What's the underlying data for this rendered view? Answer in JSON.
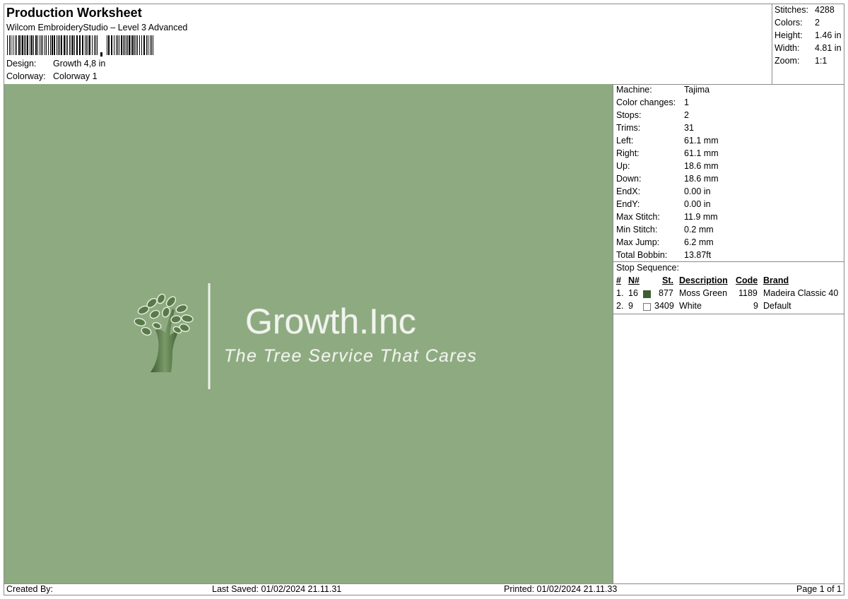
{
  "header": {
    "title": "Production Worksheet",
    "subtitle": "Wilcom EmbroideryStudio – Level 3 Advanced",
    "design_label": "Design:",
    "design_value": "Growth 4,8 in",
    "colorway_label": "Colorway:",
    "colorway_value": "Colorway 1"
  },
  "summary": [
    {
      "label": "Stitches:",
      "value": "4288"
    },
    {
      "label": "Colors:",
      "value": "2"
    },
    {
      "label": "Height:",
      "value": "1.46 in"
    },
    {
      "label": "Width:",
      "value": "4.81 in"
    },
    {
      "label": "Zoom:",
      "value": "1:1"
    }
  ],
  "design": {
    "background_color": "#8eaa80",
    "brand_name": "Growth.Inc",
    "tagline": "The Tree Service That Cares",
    "tree_color": "#4a6b3c"
  },
  "machine_info": [
    {
      "label": "Machine:",
      "value": "Tajima"
    },
    {
      "label": "Color changes:",
      "value": "1"
    },
    {
      "label": "Stops:",
      "value": "2"
    },
    {
      "label": "Trims:",
      "value": "31"
    },
    {
      "label": "Left:",
      "value": "61.1 mm"
    },
    {
      "label": "Right:",
      "value": "61.1 mm"
    },
    {
      "label": "Up:",
      "value": "18.6 mm"
    },
    {
      "label": "Down:",
      "value": "18.6 mm"
    },
    {
      "label": "EndX:",
      "value": "0.00 in"
    },
    {
      "label": "EndY:",
      "value": "0.00 in"
    },
    {
      "label": "Max Stitch:",
      "value": "11.9 mm"
    },
    {
      "label": "Min Stitch:",
      "value": "0.2 mm"
    },
    {
      "label": "Max Jump:",
      "value": "6.2 mm"
    },
    {
      "label": "Total Bobbin:",
      "value": "13.87ft"
    }
  ],
  "stop_sequence": {
    "title": "Stop Sequence:",
    "headers": {
      "num": "#",
      "n": "N#",
      "st": "St.",
      "description": "Description",
      "code": "Code",
      "brand": "Brand"
    },
    "rows": [
      {
        "num": "1.",
        "n": "16",
        "color": "#3f5e33",
        "st": "877",
        "description": "Moss Green",
        "code": "1189",
        "brand": "Madeira Classic 40"
      },
      {
        "num": "2.",
        "n": "9",
        "color": "#ffffff",
        "st": "3409",
        "description": "White",
        "code": "9",
        "brand": "Default"
      }
    ]
  },
  "footer": {
    "created_by": "Created By:",
    "last_saved": "Last Saved: 01/02/2024 21.11.31",
    "printed": "Printed: 01/02/2024 21.11.33",
    "page": "Page 1 of 1"
  }
}
